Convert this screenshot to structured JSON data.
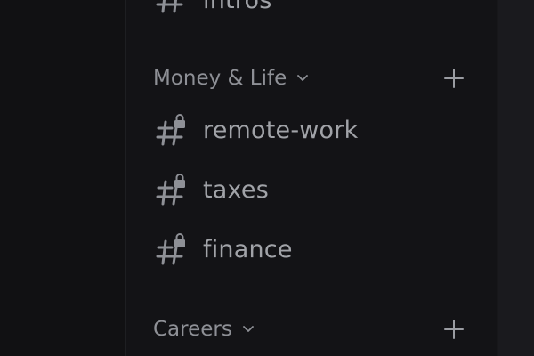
{
  "top_partial_channel": {
    "label": "intros",
    "icon": "hash-icon"
  },
  "categories": [
    {
      "label": "Money & Life",
      "chevron_icon": "chevron-down-icon",
      "add_icon": "plus-icon",
      "channels": [
        {
          "label": "remote-work",
          "icon": "locked-hash-icon"
        },
        {
          "label": "taxes",
          "icon": "locked-hash-icon"
        },
        {
          "label": "finance",
          "icon": "locked-hash-icon"
        }
      ]
    },
    {
      "label": "Careers",
      "chevron_icon": "chevron-down-icon",
      "add_icon": "plus-icon",
      "channels": []
    }
  ],
  "colors": {
    "background": "#111113",
    "panel": "#131316",
    "channel_text": "#a1a3a8",
    "category_text": "#8e9096"
  }
}
